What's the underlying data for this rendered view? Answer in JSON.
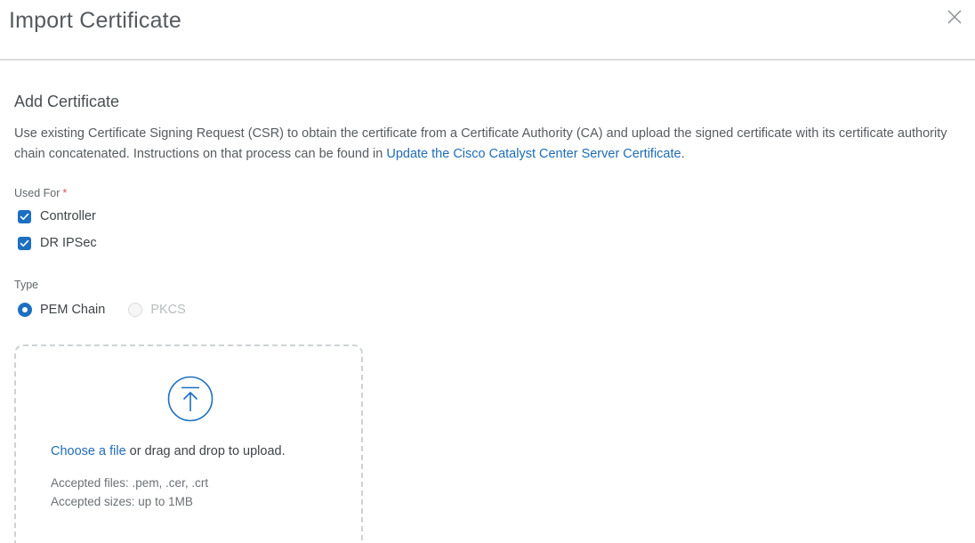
{
  "header": {
    "title": "Import Certificate"
  },
  "section": {
    "title": "Add Certificate",
    "description_part1": "Use existing Certificate Signing Request (CSR) to obtain the certificate from a Certificate Authority (CA) and upload the signed certificate with its certificate authority chain concatenated. Instructions on that process can be found in ",
    "description_link": "Update the Cisco Catalyst Center Server Certificate",
    "description_end": "."
  },
  "used_for": {
    "label": "Used For",
    "required_mark": "*",
    "options": [
      {
        "label": "Controller",
        "checked": true
      },
      {
        "label": "DR IPSec",
        "checked": true
      }
    ]
  },
  "type": {
    "label": "Type",
    "options": [
      {
        "label": "PEM Chain",
        "selected": true,
        "disabled": false
      },
      {
        "label": "PKCS",
        "selected": false,
        "disabled": true
      }
    ]
  },
  "upload": {
    "choose_link": "Choose a file",
    "drag_text": " or drag and drop to upload.",
    "accepted_files": "Accepted files: .pem, .cer, .crt",
    "accepted_sizes": "Accepted sizes: up to 1MB"
  },
  "colors": {
    "accent": "#1d6fc1",
    "link": "#1f6cb5",
    "required": "#d9534f"
  },
  "icons": {
    "close": "close-icon",
    "check": "checkmark-icon",
    "upload": "upload-arrow-icon"
  }
}
